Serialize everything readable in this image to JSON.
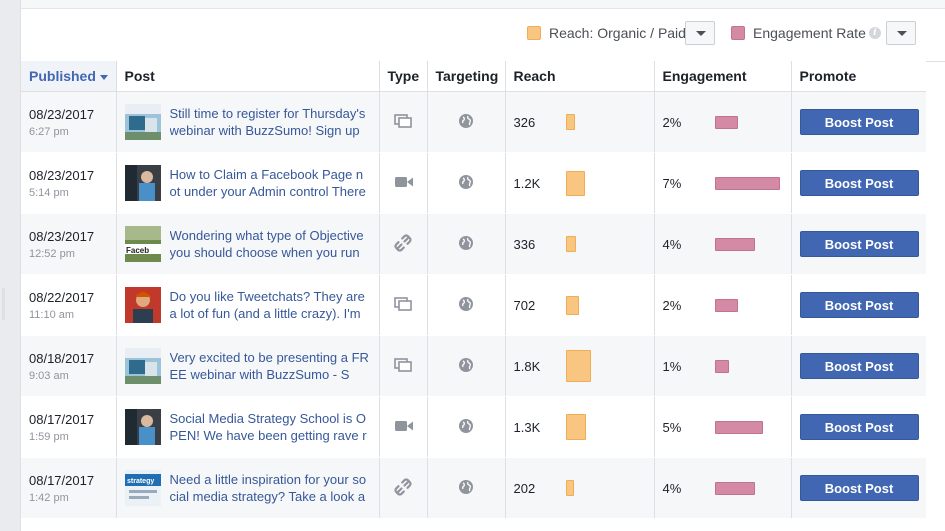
{
  "legend": {
    "reach_label": "Reach: Organic / Paid",
    "reach_color": "#f9c681",
    "engagement_label": "Engagement Rate",
    "engagement_color": "#d48aa5",
    "info_glyph": "i"
  },
  "columns": {
    "published": "Published",
    "post": "Post",
    "type": "Type",
    "targeting": "Targeting",
    "reach": "Reach",
    "engagement": "Engagement",
    "promote": "Promote"
  },
  "rows": [
    {
      "date": "08/23/2017",
      "time": "6:27 pm",
      "text": "Still time to register for Thursday's webinar with BuzzSumo! Sign up",
      "type": "photo-album-icon",
      "reach": "326",
      "reach_value": 326,
      "engagement": "2%",
      "engagement_value": 2,
      "button": "Boost Post",
      "thumb": "webinar"
    },
    {
      "date": "08/23/2017",
      "time": "5:14 pm",
      "text": "How to Claim a Facebook Page not under your Admin control There",
      "type": "video-icon",
      "reach": "1.2K",
      "reach_value": 1200,
      "engagement": "7%",
      "engagement_value": 7,
      "button": "Boost Post",
      "thumb": "person-dark"
    },
    {
      "date": "08/23/2017",
      "time": "12:52 pm",
      "text": "Wondering what type of Objective you should choose when you run",
      "type": "link-icon",
      "reach": "336",
      "reach_value": 336,
      "engagement": "4%",
      "engagement_value": 4,
      "button": "Boost Post",
      "thumb": "facebook"
    },
    {
      "date": "08/22/2017",
      "time": "11:10 am",
      "text": "Do you like Tweetchats? They are a lot of fun (and a little crazy). I'm",
      "type": "photo-album-icon",
      "reach": "702",
      "reach_value": 702,
      "engagement": "2%",
      "engagement_value": 2,
      "button": "Boost Post",
      "thumb": "person-red"
    },
    {
      "date": "08/18/2017",
      "time": "9:03 am",
      "text": "Very excited to be presenting a FREE webinar with BuzzSumo - S",
      "type": "photo-album-icon",
      "reach": "1.8K",
      "reach_value": 1800,
      "engagement": "1%",
      "engagement_value": 1,
      "button": "Boost Post",
      "thumb": "webinar"
    },
    {
      "date": "08/17/2017",
      "time": "1:59 pm",
      "text": "Social Media Strategy School is OPEN! We have been getting rave r",
      "type": "video-icon",
      "reach": "1.3K",
      "reach_value": 1300,
      "engagement": "5%",
      "engagement_value": 5,
      "button": "Boost Post",
      "thumb": "person-dark"
    },
    {
      "date": "08/17/2017",
      "time": "1:42 pm",
      "text": "Need a little inspiration for your social media strategy? Take a look a",
      "type": "link-icon",
      "reach": "202",
      "reach_value": 202,
      "engagement": "4%",
      "engagement_value": 4,
      "button": "Boost Post",
      "thumb": "strategy"
    }
  ]
}
